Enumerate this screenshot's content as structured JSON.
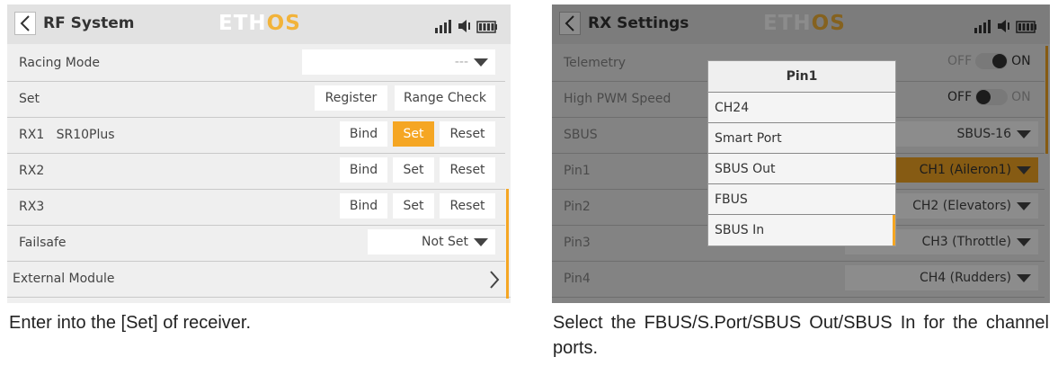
{
  "left": {
    "title": "RF System",
    "logo_main": "ETH",
    "logo_accent": "OS",
    "rows": [
      {
        "label": "Racing Mode",
        "dropdown": "---"
      },
      {
        "label": "Set",
        "btn1": "Register",
        "btn2": "Range Check"
      },
      {
        "label": "RX1   SR10Plus",
        "bind": "Bind",
        "set": "Set",
        "reset": "Reset"
      },
      {
        "label": "RX2",
        "bind": "Bind",
        "set": "Set",
        "reset": "Reset"
      },
      {
        "label": "RX3",
        "bind": "Bind",
        "set": "Set",
        "reset": "Reset"
      },
      {
        "label": "Failsafe",
        "dropdown": "Not Set"
      },
      {
        "label": "External Module"
      }
    ],
    "caption": "Enter into the [Set] of receiver."
  },
  "right": {
    "title": "RX Settings",
    "logo_main": "ETH",
    "logo_accent": "OS",
    "rows": [
      {
        "label": "Telemetry",
        "off": "OFF",
        "on": "ON"
      },
      {
        "label": "High PWM Speed",
        "off": "OFF",
        "on": "ON"
      },
      {
        "label": "SBUS",
        "value": "SBUS-16"
      },
      {
        "label": "Pin1",
        "value": "CH1 (Aileron1)"
      },
      {
        "label": "Pin2",
        "value": "CH2 (Elevators)"
      },
      {
        "label": "Pin3",
        "value": "CH3 (Throttle)"
      },
      {
        "label": "Pin4",
        "value": "CH4 (Rudders)"
      }
    ],
    "popup": {
      "title": "Pin1",
      "items": [
        "CH24",
        "Smart Port",
        "SBUS Out",
        "FBUS",
        "SBUS In"
      ]
    },
    "caption": "Select the FBUS/S.Port/SBUS Out/SBUS In for the channel ports."
  },
  "colors": {
    "accent": "#f5a623",
    "panel": "#efefef",
    "titlebar": "#e2e2e2"
  }
}
